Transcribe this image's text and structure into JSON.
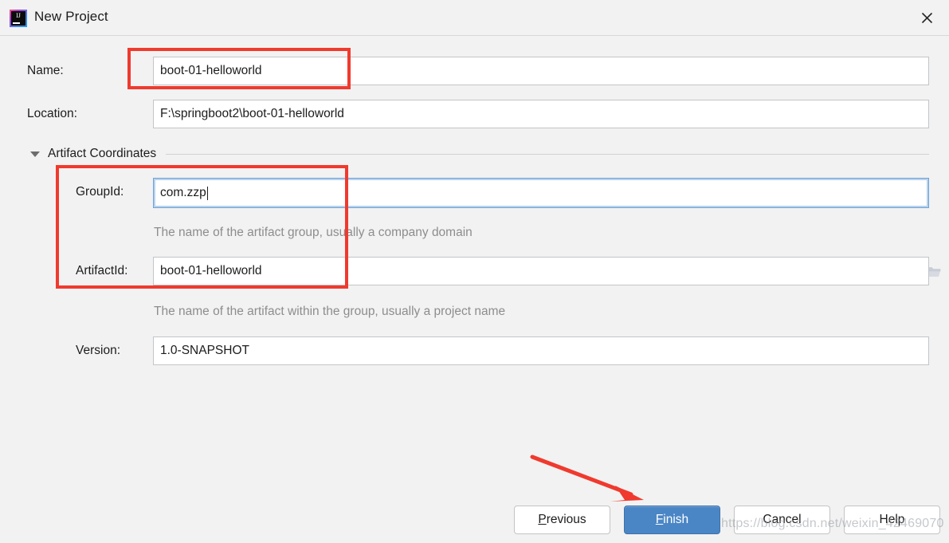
{
  "window": {
    "title": "New Project",
    "logo_icon": "intellij-idea-logo",
    "logo_letters": "IJ",
    "close_icon": "close-icon"
  },
  "colors": {
    "background": "#f2f2f2",
    "field_border": "#c2c5c9",
    "focus_border": "#6ea2d8",
    "primary_button": "#4a86c5",
    "annotation_red": "#f03a2e",
    "hint_text": "#8d8d8d"
  },
  "form": {
    "name": {
      "label": "Name:",
      "value": "boot-01-helloworld"
    },
    "location": {
      "label": "Location:",
      "value": "F:\\springboot2\\boot-01-helloworld",
      "browse_icon": "folder-icon"
    },
    "section": {
      "title": "Artifact Coordinates",
      "expanded": true,
      "toggle_icon": "chevron-down-icon"
    },
    "group_id": {
      "label": "GroupId:",
      "value": "com.zzp",
      "focused": true,
      "hint": "The name of the artifact group, usually a company domain"
    },
    "artifact_id": {
      "label": "ArtifactId:",
      "value": "boot-01-helloworld",
      "hint": "The name of the artifact within the group, usually a project name"
    },
    "version": {
      "label": "Version:",
      "value": "1.0-SNAPSHOT"
    }
  },
  "buttons": {
    "previous": {
      "label": "Previous",
      "mnemonic": "P",
      "rest": "revious"
    },
    "finish": {
      "label": "Finish",
      "mnemonic": "F",
      "rest": "inish",
      "primary": true
    },
    "cancel": {
      "label": "Cancel"
    },
    "help": {
      "label": "Help"
    }
  },
  "annotations": {
    "name_box": "red-highlight-box-name",
    "coordinates_box": "red-highlight-box-artifact-coordinates",
    "finish_arrow": "red-arrow-pointing-to-finish"
  },
  "watermark": {
    "text": "https://blog.csdn.net/weixin_42469070"
  }
}
